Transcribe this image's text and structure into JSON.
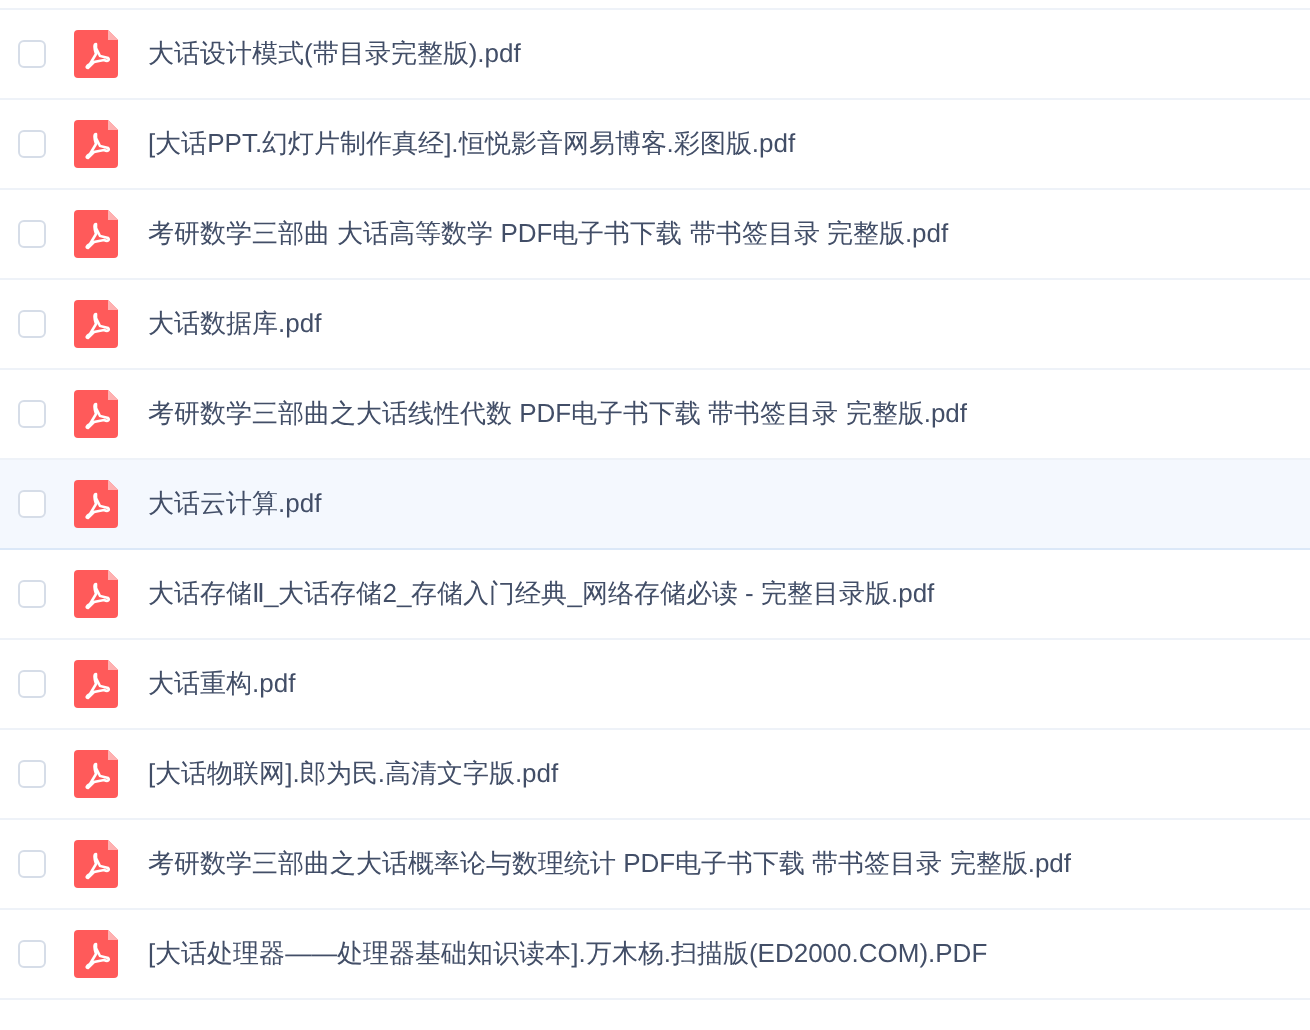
{
  "files": [
    {
      "name": "大话设计模式(带目录完整版).pdf",
      "checked": false,
      "hovered": false
    },
    {
      "name": "[大话PPT.幻灯片制作真经].恒悦影音网易博客.彩图版.pdf",
      "checked": false,
      "hovered": false
    },
    {
      "name": "考研数学三部曲 大话高等数学 PDF电子书下载 带书签目录 完整版.pdf",
      "checked": false,
      "hovered": false
    },
    {
      "name": "大话数据库.pdf",
      "checked": false,
      "hovered": false
    },
    {
      "name": "考研数学三部曲之大话线性代数 PDF电子书下载 带书签目录 完整版.pdf",
      "checked": false,
      "hovered": false
    },
    {
      "name": "大话云计算.pdf",
      "checked": false,
      "hovered": true
    },
    {
      "name": "大话存储Ⅱ_大话存储2_存储入门经典_网络存储必读 - 完整目录版.pdf",
      "checked": false,
      "hovered": false
    },
    {
      "name": "大话重构.pdf",
      "checked": false,
      "hovered": false
    },
    {
      "name": "[大话物联网].郎为民.高清文字版.pdf",
      "checked": false,
      "hovered": false
    },
    {
      "name": "考研数学三部曲之大话概率论与数理统计 PDF电子书下载 带书签目录 完整版.pdf",
      "checked": false,
      "hovered": false
    },
    {
      "name": "[大话处理器——处理器基础知识读本].万木杨.扫描版(ED2000.COM).PDF",
      "checked": false,
      "hovered": false
    }
  ]
}
